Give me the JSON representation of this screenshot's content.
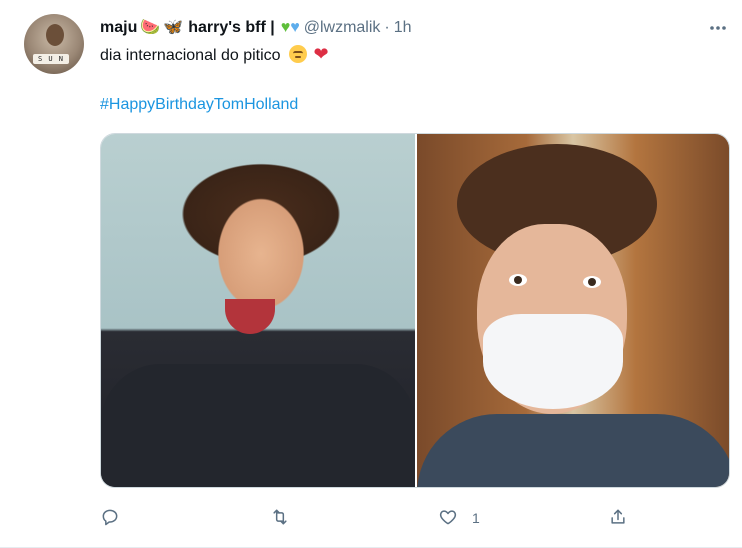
{
  "tweet": {
    "display_name": "maju",
    "display_name_suffix": "harry's bff |",
    "handle": "@lwzmalik",
    "separator": "·",
    "time": "1h",
    "text": "dia internacional do pitico",
    "hashtag": "#HappyBirthdayTomHolland",
    "avatar_sign_text": "S U N"
  },
  "emojis": {
    "watermelon": "🍉",
    "butterfly": "🦋",
    "heart_green": "♥",
    "heart_blue": "♥",
    "heart_red": "❤"
  },
  "actions": {
    "reply_icon": "reply-icon",
    "retweet_icon": "retweet-icon",
    "like_icon": "like-icon",
    "like_count": "1",
    "share_icon": "share-icon"
  },
  "colors": {
    "link": "#1b95e0",
    "muted": "#5b7083",
    "text": "#0f1419"
  }
}
